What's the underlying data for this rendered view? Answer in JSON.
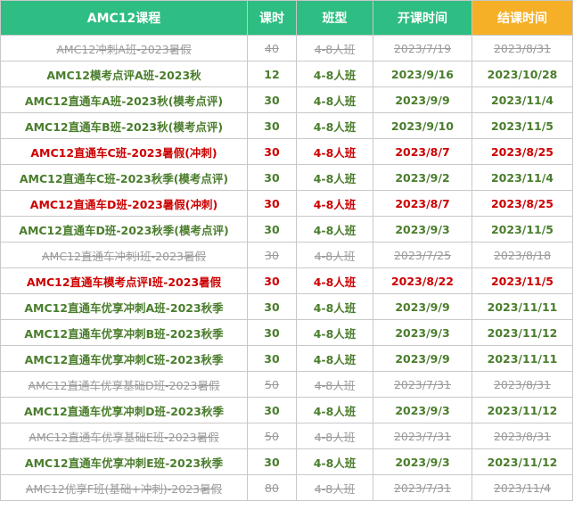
{
  "headers": [
    "AMC12课程",
    "课时",
    "班型",
    "开课时间",
    "结课时间"
  ],
  "rows": [
    {
      "status": "gray",
      "cells": [
        "AMC12冲刺A班-2023暑假",
        "40",
        "4-8人班",
        "2023/7/19",
        "2023/8/31"
      ]
    },
    {
      "status": "green",
      "cells": [
        "AMC12模考点评A班-2023秋",
        "12",
        "4-8人班",
        "2023/9/16",
        "2023/10/28"
      ]
    },
    {
      "status": "green",
      "cells": [
        "AMC12直通车A班-2023秋(模考点评)",
        "30",
        "4-8人班",
        "2023/9/9",
        "2023/11/4"
      ]
    },
    {
      "status": "green",
      "cells": [
        "AMC12直通车B班-2023秋(模考点评)",
        "30",
        "4-8人班",
        "2023/9/10",
        "2023/11/5"
      ]
    },
    {
      "status": "red",
      "cells": [
        "AMC12直通车C班-2023暑假(冲刺)",
        "30",
        "4-8人班",
        "2023/8/7",
        "2023/8/25"
      ]
    },
    {
      "status": "green",
      "cells": [
        "AMC12直通车C班-2023秋季(模考点评)",
        "30",
        "4-8人班",
        "2023/9/2",
        "2023/11/4"
      ]
    },
    {
      "status": "red",
      "cells": [
        "AMC12直通车D班-2023暑假(冲刺)",
        "30",
        "4-8人班",
        "2023/8/7",
        "2023/8/25"
      ]
    },
    {
      "status": "green",
      "cells": [
        "AMC12直通车D班-2023秋季(模考点评)",
        "30",
        "4-8人班",
        "2023/9/3",
        "2023/11/5"
      ]
    },
    {
      "status": "gray",
      "cells": [
        "AMC12直通车冲刺I班-2023暑假",
        "30",
        "4-8人班",
        "2023/7/25",
        "2023/8/18"
      ]
    },
    {
      "status": "red",
      "cells": [
        "AMC12直通车模考点评I班-2023暑假",
        "30",
        "4-8人班",
        "2023/8/22",
        "2023/11/5"
      ]
    },
    {
      "status": "green",
      "cells": [
        "AMC12直通车优享冲刺A班-2023秋季",
        "30",
        "4-8人班",
        "2023/9/9",
        "2023/11/11"
      ]
    },
    {
      "status": "green",
      "cells": [
        "AMC12直通车优享冲刺B班-2023秋季",
        "30",
        "4-8人班",
        "2023/9/3",
        "2023/11/12"
      ]
    },
    {
      "status": "green",
      "cells": [
        "AMC12直通车优享冲刺C班-2023秋季",
        "30",
        "4-8人班",
        "2023/9/9",
        "2023/11/11"
      ]
    },
    {
      "status": "gray",
      "cells": [
        "AMC12直通车优享基础D班-2023暑假",
        "50",
        "4-8人班",
        "2023/7/31",
        "2023/8/31"
      ]
    },
    {
      "status": "green",
      "cells": [
        "AMC12直通车优享冲刺D班-2023秋季",
        "30",
        "4-8人班",
        "2023/9/3",
        "2023/11/12"
      ]
    },
    {
      "status": "gray",
      "cells": [
        "AMC12直通车优享基础E班-2023暑假",
        "50",
        "4-8人班",
        "2023/7/31",
        "2023/8/31"
      ]
    },
    {
      "status": "green",
      "cells": [
        "AMC12直通车优享冲刺E班-2023秋季",
        "30",
        "4-8人班",
        "2023/9/3",
        "2023/11/12"
      ]
    },
    {
      "status": "gray",
      "cells": [
        "AMC12优享F班(基础+冲刺)-2023暑假",
        "80",
        "4-8人班",
        "2023/7/31",
        "2023/11/4"
      ]
    }
  ],
  "colors": {
    "header_green": "#2ebd82",
    "header_orange": "#f5b028",
    "active_green": "#4a7d2c",
    "highlight_red": "#cc0000",
    "ended_gray": "#9a9a9a"
  }
}
